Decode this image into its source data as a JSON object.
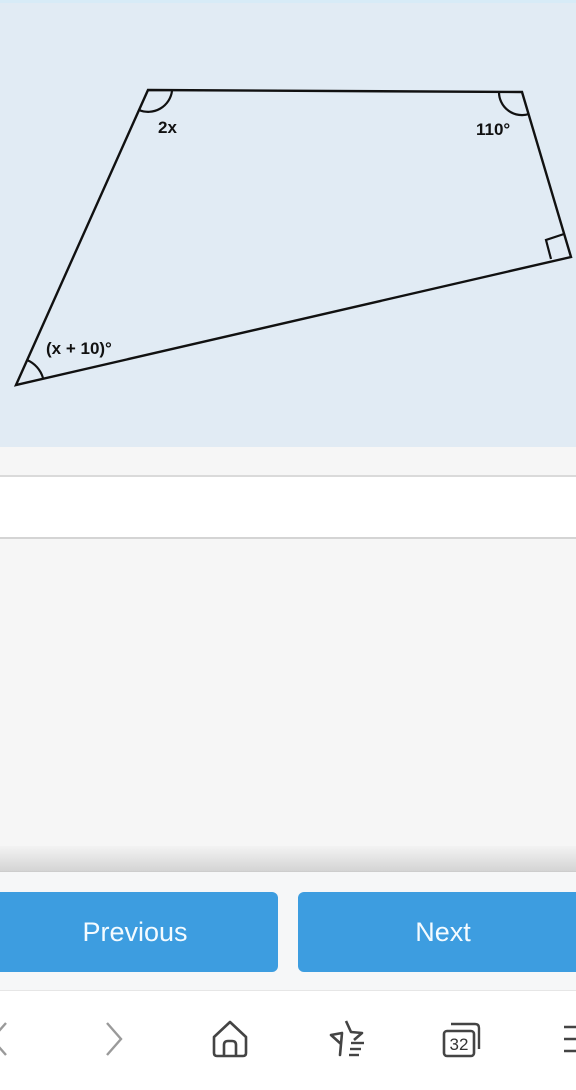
{
  "figure": {
    "shape": "quadrilateral",
    "angle_labels": {
      "top_left": "2x",
      "top_right": "110°",
      "bottom_left": "(x + 10)°",
      "right": "right angle (90°)"
    },
    "colors": {
      "background": "#e1ebf4",
      "stroke": "#111111"
    }
  },
  "navigation": {
    "previous_label": "Previous",
    "next_label": "Next",
    "button_color": "#3d9de0"
  },
  "browser_toolbar": {
    "icons": [
      "back-icon",
      "forward-icon",
      "home-icon",
      "bookmarks-icon",
      "tabs-icon",
      "menu-icon"
    ],
    "tab_count": "32"
  }
}
